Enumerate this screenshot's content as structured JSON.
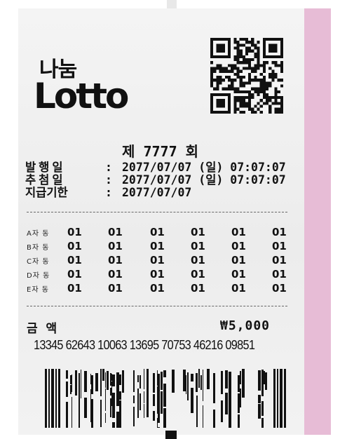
{
  "logo": {
    "korean": "나눔",
    "english": "Lotto"
  },
  "round": {
    "prefix": "제",
    "number": "7777",
    "suffix": "회"
  },
  "info": [
    {
      "label": "발행일",
      "value": "2077/07/07 (일) 07:07:07"
    },
    {
      "label": "추첨일",
      "value": "2077/07/07 (일) 07:07:07"
    },
    {
      "label": "지급기한",
      "value": "2077/07/07"
    }
  ],
  "separator": ":",
  "games": [
    {
      "label": "A자 동",
      "numbers": [
        "01",
        "01",
        "01",
        "01",
        "01",
        "01"
      ]
    },
    {
      "label": "B자 동",
      "numbers": [
        "01",
        "01",
        "01",
        "01",
        "01",
        "01"
      ]
    },
    {
      "label": "C자 동",
      "numbers": [
        "01",
        "01",
        "01",
        "01",
        "01",
        "01"
      ]
    },
    {
      "label": "D자 동",
      "numbers": [
        "01",
        "01",
        "01",
        "01",
        "01",
        "01"
      ]
    },
    {
      "label": "E자 동",
      "numbers": [
        "01",
        "01",
        "01",
        "01",
        "01",
        "01"
      ]
    }
  ],
  "amount": {
    "label": "금 액",
    "value": "₩5,000"
  },
  "serial": "13345 62643 10063 13695 70753 46216 09851",
  "colors": {
    "accent_strip": "#e7bcd6",
    "ink": "#111111",
    "paper": "#efefef"
  }
}
